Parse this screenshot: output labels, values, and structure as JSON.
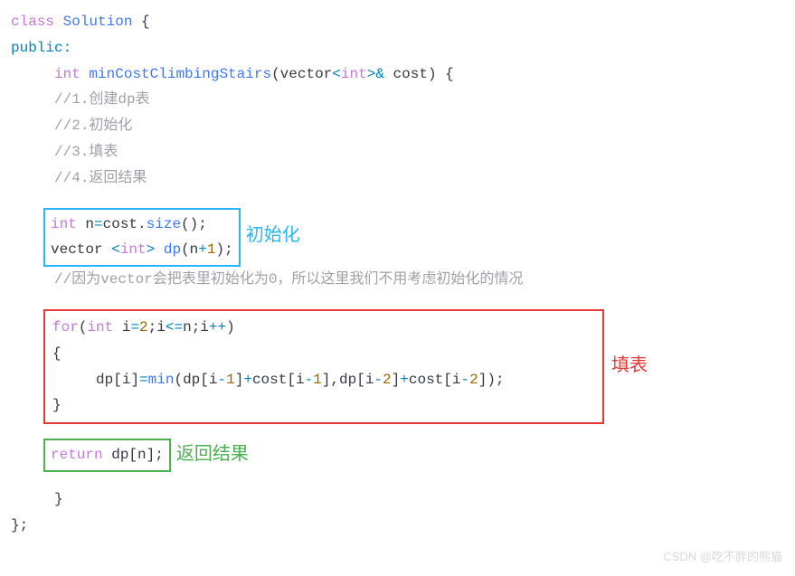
{
  "line1": {
    "class_kw": "class",
    "class_name": "Solution",
    "brace": " {"
  },
  "line2": {
    "public": "public",
    "colon": ":"
  },
  "line3": {
    "indent": "     ",
    "ret_type": "int",
    "fn_name": " minCostClimbingStairs",
    "open": "(",
    "vec": "vector",
    "lt": "<",
    "tparam": "int",
    "gt": ">",
    "amp": "&",
    "param": " cost",
    "close": ") {"
  },
  "comments": {
    "c1": "     //1.创建dp表",
    "c2": "     //2.初始化",
    "c3": "     //3.填表",
    "c4": "     //4.返回结果",
    "c5": "     //因为vector会把表里初始化为0，所以这里我们不用考虑初始化的情况"
  },
  "init": {
    "l1": {
      "type": "int",
      "ident": " n",
      "eq": "=",
      "obj": "cost",
      "dot": ".",
      "method": "size",
      "paren": "();"
    },
    "l2": {
      "vec": "vector ",
      "lt": "<",
      "tparam": "int",
      "gt": ">",
      "ident": " dp",
      "open": "(",
      "arg": "n",
      "op": "+",
      "num": "1",
      "close": ");"
    }
  },
  "fill": {
    "l1": {
      "for_kw": "for",
      "open": "(",
      "type": "int",
      "i": " i",
      "eq": "=",
      "two": "2",
      "semi": ";",
      "cond": "i",
      "le": "<=",
      "n": "n",
      "semi2": ";",
      "incr": "i",
      "pp": "++",
      "close": ")"
    },
    "l2": "{",
    "l3": {
      "indent": "     ",
      "dp": "dp",
      "b1": "[",
      "i1": "i",
      "b2": "]",
      "eq": "=",
      "min": "min",
      "open": "(",
      "dp2": "dp",
      "b3": "[",
      "i2": "i",
      "m1": "-",
      "one1": "1",
      "b4": "]",
      "p1": "+",
      "cost1": "cost",
      "b5": "[",
      "i3": "i",
      "m2": "-",
      "one2": "1",
      "b6": "]",
      "comma": ",",
      "dp3": "dp",
      "b7": "[",
      "i4": "i",
      "m3": "-",
      "two2": "2",
      "b8": "]",
      "p2": "+",
      "cost2": "cost",
      "b9": "[",
      "i5": "i",
      "m4": "-",
      "two3": "2",
      "b10": "]",
      "close": ");"
    },
    "l4": "}"
  },
  "ret": {
    "kw": "return",
    "sp": " ",
    "dp": "dp",
    "b1": "[",
    "n": "n",
    "b2": "];"
  },
  "labels": {
    "init": "初始化",
    "fill": "填表",
    "ret": "返回结果"
  },
  "closing": {
    "brace1": "     }",
    "brace2": "};"
  },
  "watermark": "CSDN @吃不胖的熊猫"
}
